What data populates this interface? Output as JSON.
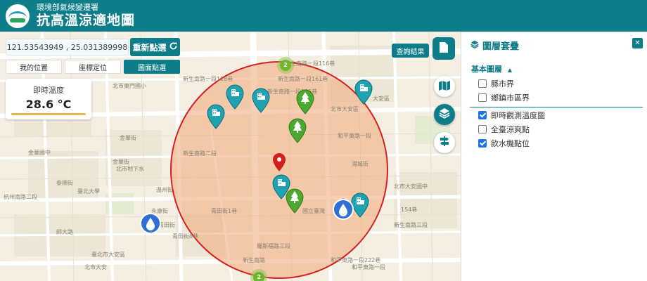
{
  "header": {
    "org": "環境部氣候變遷署",
    "title": "抗高溫涼適地圖"
  },
  "controls": {
    "coordinates": "121.53543949 , 25.031389998",
    "reselect_label": "重新點選",
    "modes": [
      "我的位置",
      "座標定位",
      "圖面點選"
    ],
    "active_mode": "圖面點選",
    "query_label": "查詢結果"
  },
  "temperature": {
    "label": "即時溫度",
    "value": "28.6 °C"
  },
  "panel": {
    "title": "圖層套疊",
    "group_title": "基本圖層",
    "layers": [
      {
        "label": "縣市界",
        "checked": false
      },
      {
        "label": "鄉鎮市區界",
        "checked": false
      },
      {
        "label": "即時觀測溫度圖",
        "checked": true
      },
      {
        "label": "全臺涼爽點",
        "checked": false
      },
      {
        "label": "飲水機點位",
        "checked": true
      }
    ]
  },
  "map": {
    "clusters": [
      "2",
      "2"
    ],
    "street_labels": [
      "新生南路一段116巷",
      "新生南路一段118巷",
      "新生南路一段161巷",
      "新生南路一段165巷",
      "北市東門國小",
      "北市大安區",
      "新生南路二段",
      "金華街",
      "大安區",
      "金華國中",
      "北市地下水",
      "和平東路一段",
      "溫州街",
      "浦城街",
      "青田街1巷",
      "青田街8巷",
      "羅斯福路三段",
      "永康街",
      "和平東路一段222巷",
      "154巷",
      "新生南路三段",
      "泰順街",
      "臺北市大安區",
      "北市大安國中",
      "國立臺灣",
      "金華街",
      "和平東路一段",
      "北市大安",
      "杭州南路二段",
      "臺北大學",
      "師大路",
      "青田街",
      "新生南路"
    ]
  },
  "colors": {
    "primary": "#0e7d8a",
    "buffer_fill": "#f0a878",
    "buffer_stroke": "#d42020",
    "tree_marker": "#4ca830",
    "building_marker": "#1fa3b3",
    "water_marker": "#2f6fd6",
    "selection_marker": "#d41f1f"
  }
}
